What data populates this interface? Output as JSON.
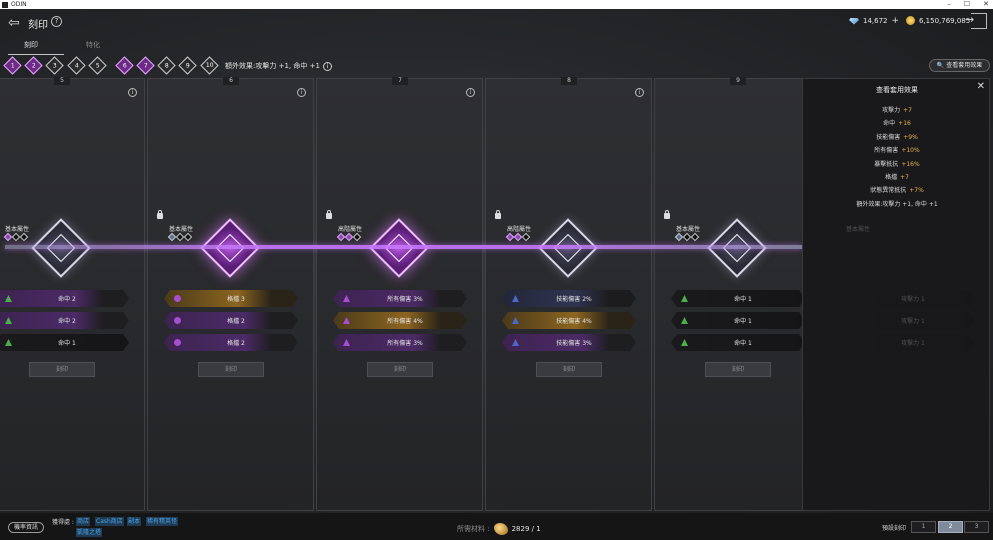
{
  "window": {
    "title": "ODIN",
    "controls": [
      "–",
      "☐",
      "✕"
    ]
  },
  "header": {
    "title": "刻印",
    "help": "?"
  },
  "currency": {
    "gems": "14,672",
    "gold": "6,150,769,085",
    "plus": "+"
  },
  "tabs": [
    {
      "label": "刻印",
      "active": true
    },
    {
      "label": "特化",
      "active": false
    }
  ],
  "progress": {
    "nodes": [
      "1",
      "2",
      "3",
      "4",
      "5",
      "6",
      "7",
      "8",
      "9",
      "10"
    ],
    "filled": 7,
    "bonus": "額外效果:攻擊力 +1, 命中 +1",
    "info": "i"
  },
  "view_effects_button": "查看套用效果",
  "columns": [
    {
      "num": "5",
      "attr": "基本屬性",
      "emblem": "silver",
      "locked": false,
      "stats": [
        {
          "label": "命中 2",
          "style": "purple",
          "marker": "tri",
          "color": "green"
        },
        {
          "label": "命中 2",
          "style": "purple",
          "marker": "tri",
          "color": "green"
        },
        {
          "label": "命中 1",
          "style": "dark",
          "marker": "tri",
          "color": "green"
        }
      ],
      "button": "刻印"
    },
    {
      "num": "6",
      "attr": "基本屬性",
      "emblem": "purple",
      "locked": true,
      "stats": [
        {
          "label": "格擋 3",
          "style": "gold",
          "marker": "dot",
          "color": "purple"
        },
        {
          "label": "格擋 2",
          "style": "purple",
          "marker": "dot",
          "color": "purple"
        },
        {
          "label": "格擋 2",
          "style": "purple",
          "marker": "dot",
          "color": "purple"
        }
      ],
      "button": "刻印"
    },
    {
      "num": "7",
      "attr": "高階屬性",
      "emblem": "purple",
      "locked": true,
      "stats": [
        {
          "label": "所有傷害 3%",
          "style": "purple",
          "marker": "tri",
          "color": "purple"
        },
        {
          "label": "所有傷害 4%",
          "style": "gold",
          "marker": "tri",
          "color": "purple"
        },
        {
          "label": "所有傷害 3%",
          "style": "purple",
          "marker": "tri",
          "color": "purple"
        }
      ],
      "button": "刻印"
    },
    {
      "num": "8",
      "attr": "高階屬性",
      "emblem": "silver",
      "locked": true,
      "stats": [
        {
          "label": "技能傷害 2%",
          "style": "blue",
          "marker": "tri",
          "color": "blue"
        },
        {
          "label": "技能傷害 4%",
          "style": "gold",
          "marker": "tri",
          "color": "blue"
        },
        {
          "label": "技能傷害 3%",
          "style": "purple",
          "marker": "tri",
          "color": "blue"
        }
      ],
      "button": "刻印"
    },
    {
      "num": "9",
      "attr": "基本屬性",
      "emblem": "silver",
      "locked": true,
      "stats": [
        {
          "label": "命中 1",
          "style": "dark",
          "marker": "tri",
          "color": "green"
        },
        {
          "label": "命中 1",
          "style": "dark",
          "marker": "tri",
          "color": "green"
        },
        {
          "label": "命中 1",
          "style": "dark",
          "marker": "tri",
          "color": "green"
        }
      ],
      "button": "刻印"
    }
  ],
  "ghost_column": {
    "attr": "基本屬性",
    "stats": [
      "攻擊力 1",
      "攻擊力 1",
      "攻擊力 1"
    ]
  },
  "panel": {
    "title": "查看套用效果",
    "close": "✕",
    "effects": [
      {
        "name": "攻擊力",
        "value": "+7"
      },
      {
        "name": "命中",
        "value": "+16"
      },
      {
        "name": "技能傷害",
        "value": "+9%"
      },
      {
        "name": "所有傷害",
        "value": "+10%"
      },
      {
        "name": "暴擊抵抗",
        "value": "+16%"
      },
      {
        "name": "格擋",
        "value": "+7"
      },
      {
        "name": "狀態異常抵抗",
        "value": "+7%"
      }
    ],
    "bonus": "額外效果:攻擊力 +1, 命中 +1"
  },
  "bottom": {
    "prob_button": "機率資訊",
    "source_label": "獲得處 :",
    "sources": [
      "商店",
      "Cash商店",
      "副本",
      "稀有精英怪",
      "凱隆之塔"
    ],
    "cost_label": "所需材料 :",
    "cost_amount": "2829 / 1",
    "preset_label": "預設刻印",
    "presets": [
      "1",
      "2",
      "3"
    ],
    "active_preset": "2"
  }
}
